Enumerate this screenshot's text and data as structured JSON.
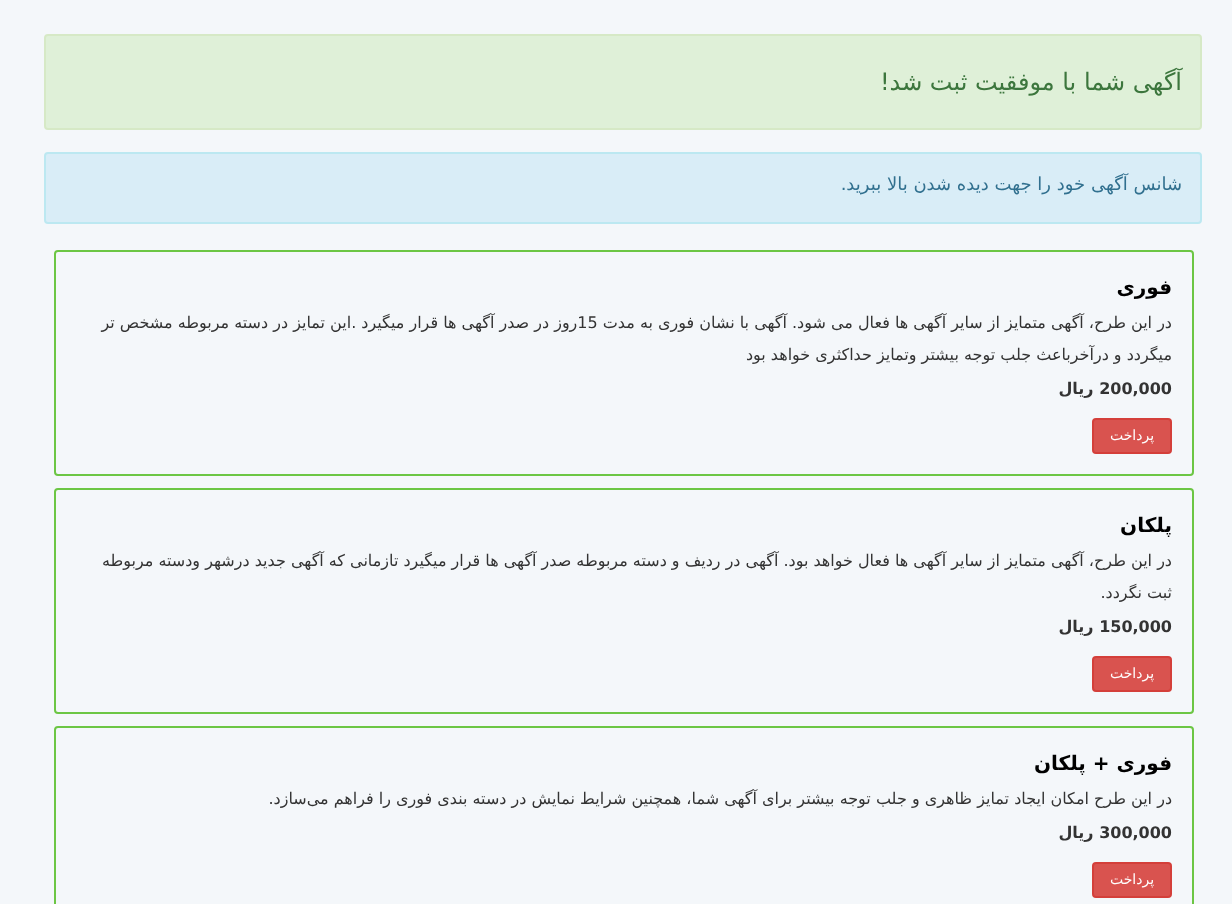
{
  "alerts": [
    {
      "kind": "success",
      "text": "آگهی شما با موفقیت ثبت شد!"
    },
    {
      "kind": "info",
      "text": "شانس آگهی خود را جهت دیده شدن بالا ببرید."
    }
  ],
  "plans": [
    {
      "title": "فوری",
      "description": "در این طرح، آگهی متمایز از سایر آگهی ها فعال می شود. آگهی با نشان فوری به مدت 15روز در صدر آگهی ها قرار میگیرد .این تمایز در دسته مربوطه مشخص تر میگردد و درآخرباعث جلب توجه بیشتر وتمایز حداکثری خواهد بود",
      "price": "200,000 ریال",
      "button": "پرداخت"
    },
    {
      "title": "پلکان",
      "description": "در این طرح، آگهی متمایز از سایر آگهی ها فعال خواهد بود. آگهی در ردیف و دسته مربوطه صدر آگهی ها قرار میگیرد تازمانی که آگهی جدید درشهر ودسته مربوطه ثبت نگردد.",
      "price": "150,000 ریال",
      "button": "پرداخت"
    },
    {
      "title": "فوری + پلکان",
      "description": "در این طرح امکان ایجاد تمایز ظاهری و جلب توجه بیشتر برای آگهی شما، همچنین شرایط نمایش در دسته بندی فوری را فراهم می‌سازد.",
      "price": "300,000 ریال",
      "button": "پرداخت"
    }
  ]
}
